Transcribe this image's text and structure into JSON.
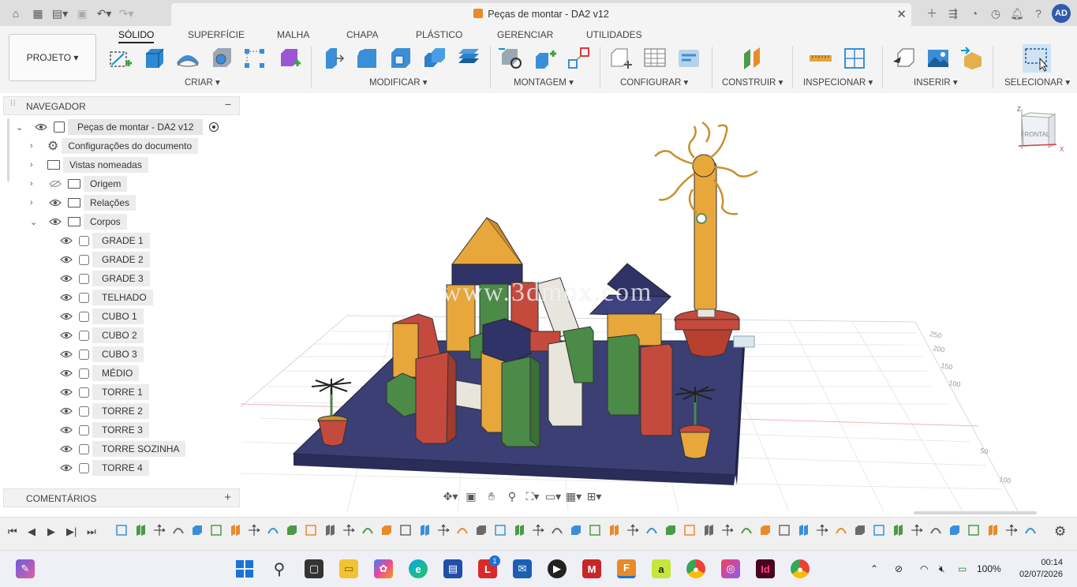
{
  "titlebar": {
    "document_title": "Peças de montar - DA2 v12",
    "user_initials": "AD"
  },
  "ribbon": {
    "project_label": "PROJETO",
    "tabs": [
      {
        "label": "SÓLIDO",
        "active": true
      },
      {
        "label": "SUPERFÍCIE"
      },
      {
        "label": "MALHA"
      },
      {
        "label": "CHAPA"
      },
      {
        "label": "PLÁSTICO"
      },
      {
        "label": "GERENCIAR"
      },
      {
        "label": "UTILIDADES"
      }
    ],
    "groups": {
      "criar": "CRIAR",
      "modificar": "MODIFICAR",
      "montagem": "MONTAGEM",
      "configurar": "CONFIGURAR",
      "construir": "CONSTRUIR",
      "inspecionar": "INSPECIONAR",
      "inserir": "INSERIR",
      "selecionar": "SELECIONAR"
    }
  },
  "navigator": {
    "title": "NAVEGADOR",
    "root": "Peças de montar - DA2 v12",
    "items": {
      "config": "Configurações do documento",
      "vistas": "Vistas nomeadas",
      "origem": "Origem",
      "relacoes": "Relações",
      "corpos": "Corpos"
    },
    "bodies": [
      "GRADE 1",
      "GRADE 2",
      "GRADE 3",
      "TELHADO",
      "CUBO 1",
      "CUBO 2",
      "CUBO 3",
      "MÉDIO",
      "TORRE 1",
      "TORRE 2",
      "TORRE 3",
      "TORRE SOZINHA",
      "TORRE 4"
    ]
  },
  "comments": {
    "title": "COMENTÁRIOS"
  },
  "viewport": {
    "viewcube_label": "FRONTAL",
    "axis_z": "Z",
    "axis_x": "X",
    "watermark": "www.3dmox.com",
    "ruler": [
      "250",
      "200",
      "150",
      "100",
      "50",
      "100"
    ]
  },
  "taskbar": {
    "battery": "100%",
    "time": "00:14",
    "date": "02/07/2026",
    "badge_count": "1"
  },
  "colors": {
    "accent": "#0696d7",
    "board": "#3b3f73",
    "yellow": "#e7a73a",
    "red": "#c44a3d",
    "green": "#4b8a47",
    "white": "#e8e6dc",
    "navy": "#2f3367"
  }
}
